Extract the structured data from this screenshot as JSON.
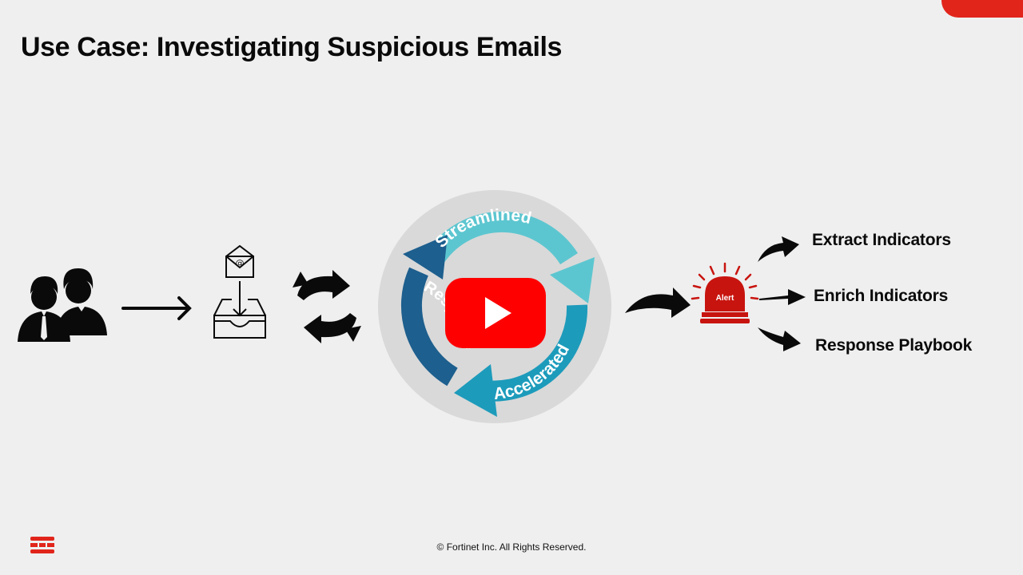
{
  "slide": {
    "title": "Use Case: Investigating Suspicious Emails",
    "cycle_labels": {
      "top": "Streamlined",
      "bottom": "Accelerated",
      "left": "Response"
    },
    "alert_label": "Alert",
    "outcomes": [
      {
        "label": "Extract Indicators"
      },
      {
        "label": "Enrich Indicators"
      },
      {
        "label": "Response Playbook"
      }
    ],
    "footer": "© Fortinet Inc. All Rights Reserved.",
    "colors": {
      "accent_red": "#e1251b",
      "alert_red": "#c8140f",
      "play_red": "#ff0000",
      "cycle_dark_blue": "#1d5f8e",
      "cycle_teal": "#1d9bbb",
      "cycle_light_teal": "#5cc6d0",
      "disc_gray": "#d6d6d6"
    },
    "icons": [
      "users-icon",
      "arrow-right-icon",
      "inbox-email-icon",
      "exchange-arrows-icon",
      "cycle-icon",
      "play-button-icon",
      "alert-siren-icon",
      "fortinet-logo-icon"
    ]
  }
}
